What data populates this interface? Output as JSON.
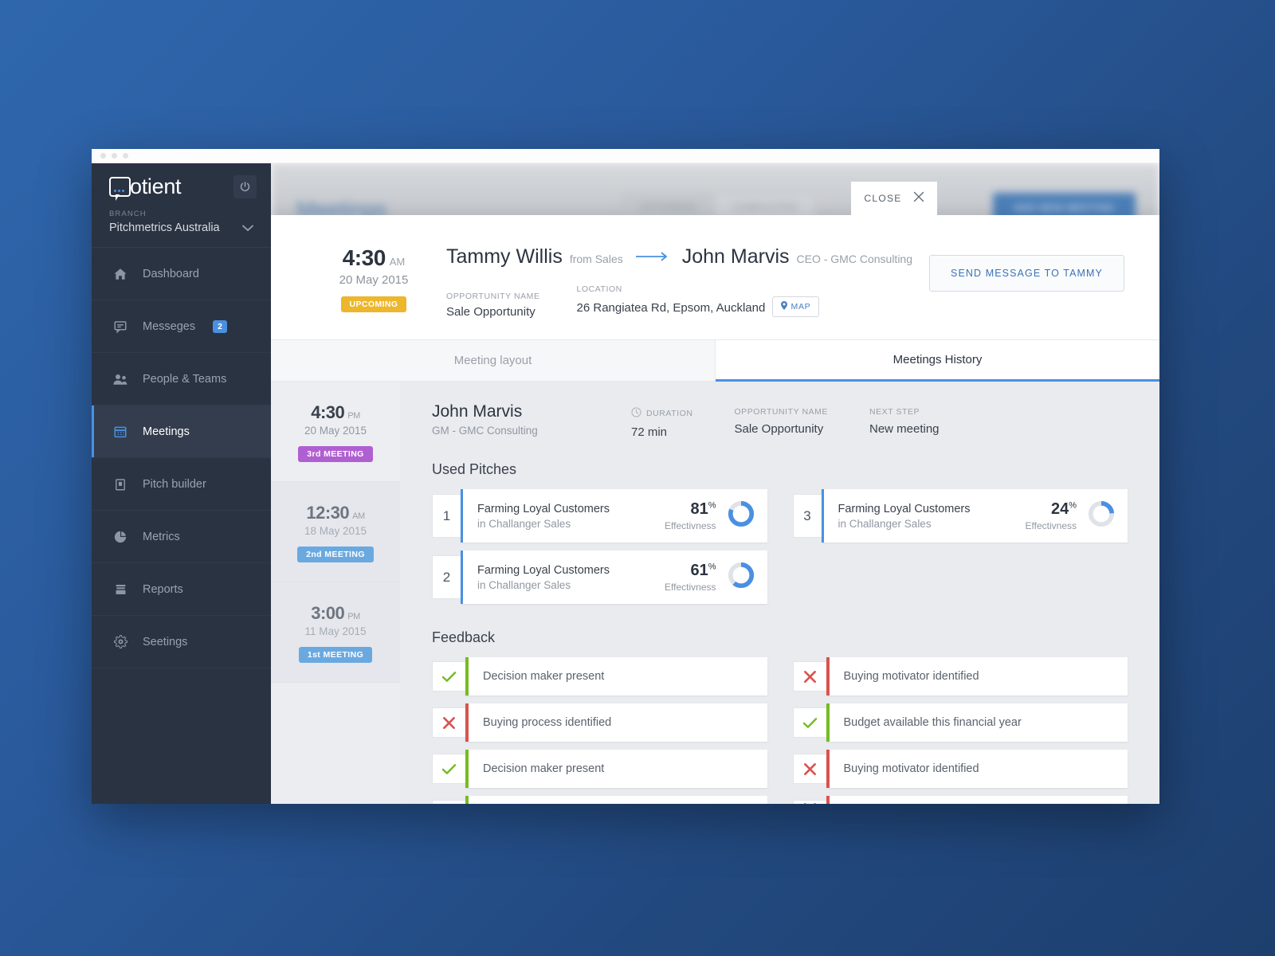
{
  "window": {
    "dots": 3
  },
  "sidebar": {
    "brand": "otient",
    "brand_full": "Qotient",
    "power_icon": "power-icon",
    "branch_label": "BRANCH",
    "branch_name": "Pitchmetrics Australia",
    "items": [
      {
        "label": "Dashboard",
        "icon": "home-icon",
        "badge": null,
        "active": false
      },
      {
        "label": "Messeges",
        "icon": "chat-icon",
        "badge": "2",
        "active": false
      },
      {
        "label": "People & Teams",
        "icon": "people-icon",
        "badge": null,
        "active": false
      },
      {
        "label": "Meetings",
        "icon": "calendar-icon",
        "badge": null,
        "active": true
      },
      {
        "label": "Pitch builder",
        "icon": "clipboard-icon",
        "badge": null,
        "active": false
      },
      {
        "label": "Metrics",
        "icon": "pie-icon",
        "badge": null,
        "active": false
      },
      {
        "label": "Reports",
        "icon": "archive-icon",
        "badge": null,
        "active": false
      },
      {
        "label": "Seetings",
        "icon": "gear-icon",
        "badge": null,
        "active": false
      }
    ]
  },
  "background_page": {
    "title": "Meetings",
    "segment": [
      "UPCOMING",
      "COMPLETED"
    ],
    "segment_active": "UPCOMING",
    "add_button": "ADD NEW MEETING"
  },
  "close_tab": {
    "label": "CLOSE",
    "icon": "close-icon"
  },
  "modal": {
    "header": {
      "time": "4:30",
      "ampm": "AM",
      "date": "20 May 2015",
      "status_pill": "UPCOMING",
      "from_person": "Tammy Willis",
      "from_role": "from Sales",
      "arrow_icon": "arrow-right-icon",
      "to_person": "John Marvis",
      "to_role": "CEO - GMC Consulting",
      "opportunity_label": "OPPORTUNITY NAME",
      "opportunity_value": "Sale Opportunity",
      "location_label": "LOCATION",
      "location_value": "26 Rangiatea Rd, Epsom, Auckland",
      "map_button": "MAP",
      "map_icon": "pin-icon",
      "send_message_button": "SEND MESSAGE TO TAMMY"
    },
    "tabs": [
      {
        "label": "Meeting layout",
        "active": false
      },
      {
        "label": "Meetings History",
        "active": true
      }
    ],
    "history": [
      {
        "time": "4:30",
        "ampm": "PM",
        "date": "20 May 2015",
        "pill": "3rd MEETING",
        "pill_class": "m3",
        "selected": true
      },
      {
        "time": "12:30",
        "ampm": "AM",
        "date": "18 May 2015",
        "pill": "2nd MEETING",
        "pill_class": "m2",
        "selected": false
      },
      {
        "time": "3:00",
        "ampm": "PM",
        "date": "11 May 2015",
        "pill": "1st MEETING",
        "pill_class": "m1",
        "selected": false
      }
    ],
    "detail": {
      "person_name": "John Marvis",
      "person_role": "GM - GMC Consulting",
      "duration_label": "DURATION",
      "duration_value": "72 min",
      "duration_icon": "clock-icon",
      "opportunity_label": "OPPORTUNITY NAME",
      "opportunity_value": "Sale Opportunity",
      "next_step_label": "NEXT STEP",
      "next_step_value": "New meeting",
      "pitches_title": "Used Pitches",
      "effectiveness_label": "Effectivness",
      "pitches_left": [
        {
          "num": "1",
          "title": "Farming Loyal Customers",
          "subtitle": "in Challanger Sales",
          "pct": "81",
          "pct_symbol": "%"
        },
        {
          "num": "2",
          "title": "Farming Loyal Customers",
          "subtitle": "in Challanger Sales",
          "pct": "61",
          "pct_symbol": "%"
        }
      ],
      "pitches_right": [
        {
          "num": "3",
          "title": "Farming Loyal Customers",
          "subtitle": "in Challanger Sales",
          "pct": "24",
          "pct_symbol": "%"
        }
      ],
      "feedback_title": "Feedback",
      "feedback_left": [
        {
          "text": "Decision maker present",
          "state": "ok",
          "icon": "check-icon"
        },
        {
          "text": "Buying process identified",
          "state": "no",
          "icon": "cross-icon"
        },
        {
          "text": "Decision maker present",
          "state": "ok",
          "icon": "check-icon"
        },
        {
          "text": "",
          "state": "ok",
          "icon": "check-icon"
        }
      ],
      "feedback_right": [
        {
          "text": "Buying motivator identified",
          "state": "no",
          "icon": "cross-icon"
        },
        {
          "text": "Budget available this financial year",
          "state": "ok",
          "icon": "check-icon"
        },
        {
          "text": "Buying motivator identified",
          "state": "no",
          "icon": "cross-icon"
        },
        {
          "text": "",
          "state": "no",
          "icon": "cross-icon"
        }
      ]
    }
  },
  "colors": {
    "accent_blue": "#4a90e2",
    "sidebar_bg": "#2a3342",
    "green": "#76bc21",
    "red": "#d9534f",
    "amber": "#edb62c",
    "purple": "#b05fd2"
  }
}
